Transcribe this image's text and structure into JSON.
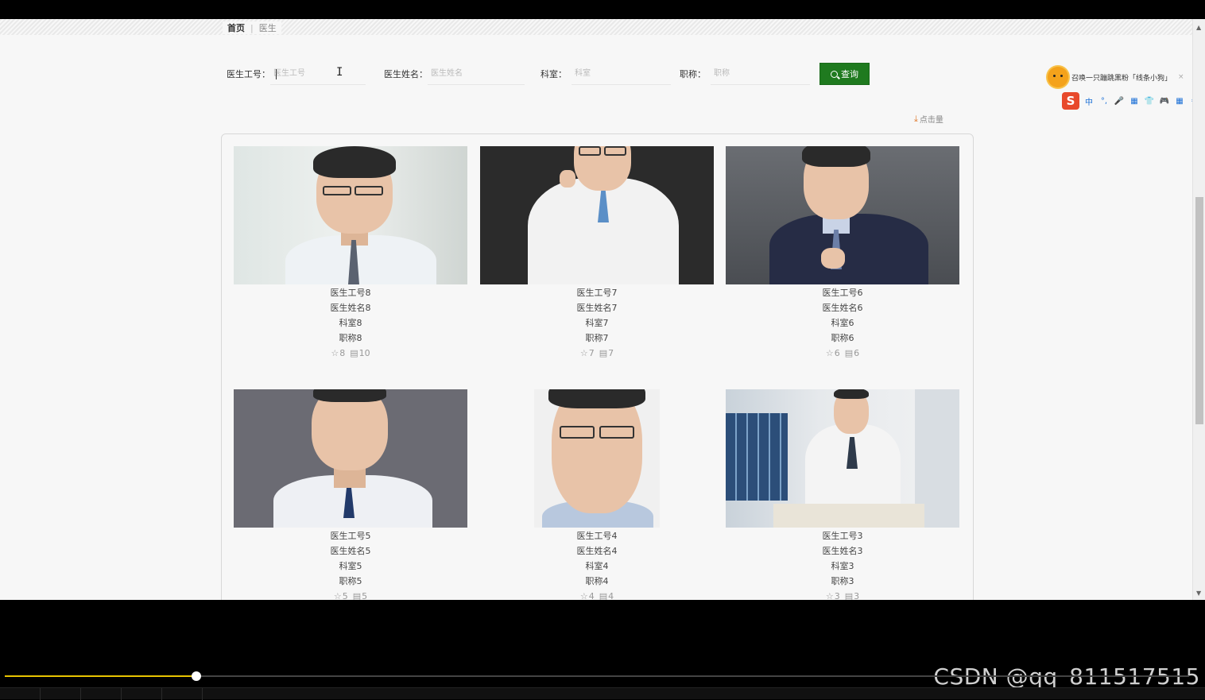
{
  "breadcrumb": {
    "home": "首页",
    "current": "医生"
  },
  "search": {
    "fields": [
      {
        "label": "医生工号：",
        "placeholder": "医生工号"
      },
      {
        "label": "医生姓名：",
        "placeholder": "医生姓名"
      },
      {
        "label": "科室：",
        "placeholder": "科室"
      },
      {
        "label": "职称：",
        "placeholder": "职称"
      }
    ],
    "button_label": "查询"
  },
  "sort": {
    "label": "点击量"
  },
  "doctors": [
    {
      "id": "医生工号8",
      "name": "医生姓名8",
      "dept": "科室8",
      "title": "职称8",
      "likes": "8",
      "comments": "10"
    },
    {
      "id": "医生工号7",
      "name": "医生姓名7",
      "dept": "科室7",
      "title": "职称7",
      "likes": "7",
      "comments": "7"
    },
    {
      "id": "医生工号6",
      "name": "医生姓名6",
      "dept": "科室6",
      "title": "职称6",
      "likes": "6",
      "comments": "6"
    },
    {
      "id": "医生工号5",
      "name": "医生姓名5",
      "dept": "科室5",
      "title": "职称5",
      "likes": "5",
      "comments": "5"
    },
    {
      "id": "医生工号4",
      "name": "医生姓名4",
      "dept": "科室4",
      "title": "职称4",
      "likes": "4",
      "comments": "4"
    },
    {
      "id": "医生工号3",
      "name": "医生姓名3",
      "dept": "科室3",
      "title": "职称3",
      "likes": "3",
      "comments": "3"
    }
  ],
  "ime": {
    "message": "召唤一只蹦跳黑粉「线条小狗」",
    "close": "×",
    "logo": "S",
    "tools": [
      "中",
      "°,",
      "🎤",
      "▦",
      "👕",
      "🎮",
      "▦",
      "⚙"
    ]
  },
  "player": {
    "progress": 0.162
  },
  "watermark": "CSDN @qq_811517515",
  "colors": {
    "accent": "#1f7a1f",
    "progress": "#e8c400"
  }
}
